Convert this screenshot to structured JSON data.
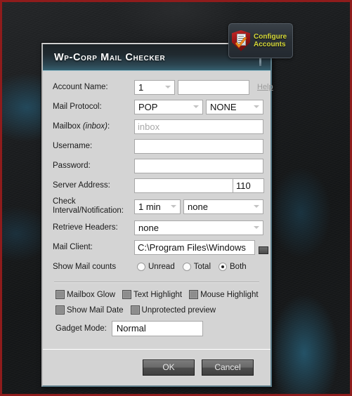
{
  "gadget": {
    "icon": "shield-check-icon",
    "line1": "Configure",
    "line2": "Accounts"
  },
  "dialog": {
    "title": "Wp-Corp Mail Checker",
    "fields": {
      "account_name": {
        "label": "Account Name:",
        "select_value": "1",
        "text_value": "",
        "help_label": "Help"
      },
      "mail_protocol": {
        "label": "Mail Protocol:",
        "protocol_value": "POP",
        "security_value": "NONE"
      },
      "mailbox": {
        "label_main": "Mailbox",
        "label_italic": "(inbox)",
        "label_suffix": ":",
        "value": "",
        "placeholder": "inbox"
      },
      "username": {
        "label": "Username:",
        "value": ""
      },
      "password": {
        "label": "Password:",
        "value": ""
      },
      "server_address": {
        "label": "Server Address:",
        "value": "",
        "port": "110"
      },
      "check_interval": {
        "label_line1": "Check",
        "label_line2": "Interval/Notification:",
        "interval_value": "1 min",
        "notification_value": "none"
      },
      "retrieve_headers": {
        "label": "Retrieve Headers:",
        "value": "none"
      },
      "mail_client": {
        "label": "Mail Client:",
        "value": "C:\\Program Files\\Windows"
      },
      "show_mail_counts": {
        "label": "Show Mail counts",
        "options": [
          {
            "label": "Unread",
            "selected": false
          },
          {
            "label": "Total",
            "selected": false
          },
          {
            "label": "Both",
            "selected": true
          }
        ]
      }
    },
    "checkboxes": [
      {
        "label": "Mailbox Glow",
        "checked": false
      },
      {
        "label": "Text Highlight",
        "checked": false
      },
      {
        "label": "Mouse Highlight",
        "checked": false
      },
      {
        "label": "Show Mail Date",
        "checked": false
      },
      {
        "label": "Unprotected preview",
        "checked": false
      }
    ],
    "gadget_mode": {
      "label": "Gadget Mode:",
      "value": "Normal"
    },
    "buttons": {
      "ok": "OK",
      "cancel": "Cancel"
    }
  },
  "colors": {
    "accent_teal": "#35606f",
    "titlebar_edge": "#8fb9c6",
    "dialog_bg": "#d4d4d4",
    "shield_red": "#c62828",
    "gadget_text": "#d6d93a",
    "frame_red": "#8f1c1c"
  }
}
